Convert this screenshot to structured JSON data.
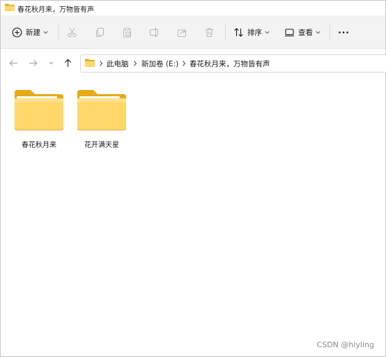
{
  "window": {
    "title": "春花秋月来，万物皆有声",
    "title_icon": "folder-icon"
  },
  "toolbar": {
    "new_label": "新建",
    "sort_label": "排序",
    "view_label": "查看",
    "more_label": "···",
    "icons": [
      "add-circle-icon",
      "cut-icon",
      "copy-icon",
      "paste-icon",
      "rename-icon",
      "share-icon",
      "delete-icon",
      "sort-icon",
      "view-icon",
      "more-icon"
    ]
  },
  "address": {
    "crumbs": [
      "此电脑",
      "新加卷 (E:)",
      "春花秋月来，万物皆有声"
    ],
    "nav_icons": [
      "back-arrow-icon",
      "forward-arrow-icon",
      "recent-chevron-icon",
      "up-arrow-icon"
    ]
  },
  "content": {
    "items": [
      {
        "name": "春花秋月来",
        "type": "folder"
      },
      {
        "name": "花开满天星",
        "type": "folder"
      }
    ]
  },
  "watermark": "CSDN @hlyling",
  "colors": {
    "folder_back": "#e8a917",
    "folder_front": "#ffd76b",
    "toolbar_bg": "#f3f3f3",
    "icon_disabled": "#b8b8b8",
    "icon_active": "#1a1a1a"
  }
}
